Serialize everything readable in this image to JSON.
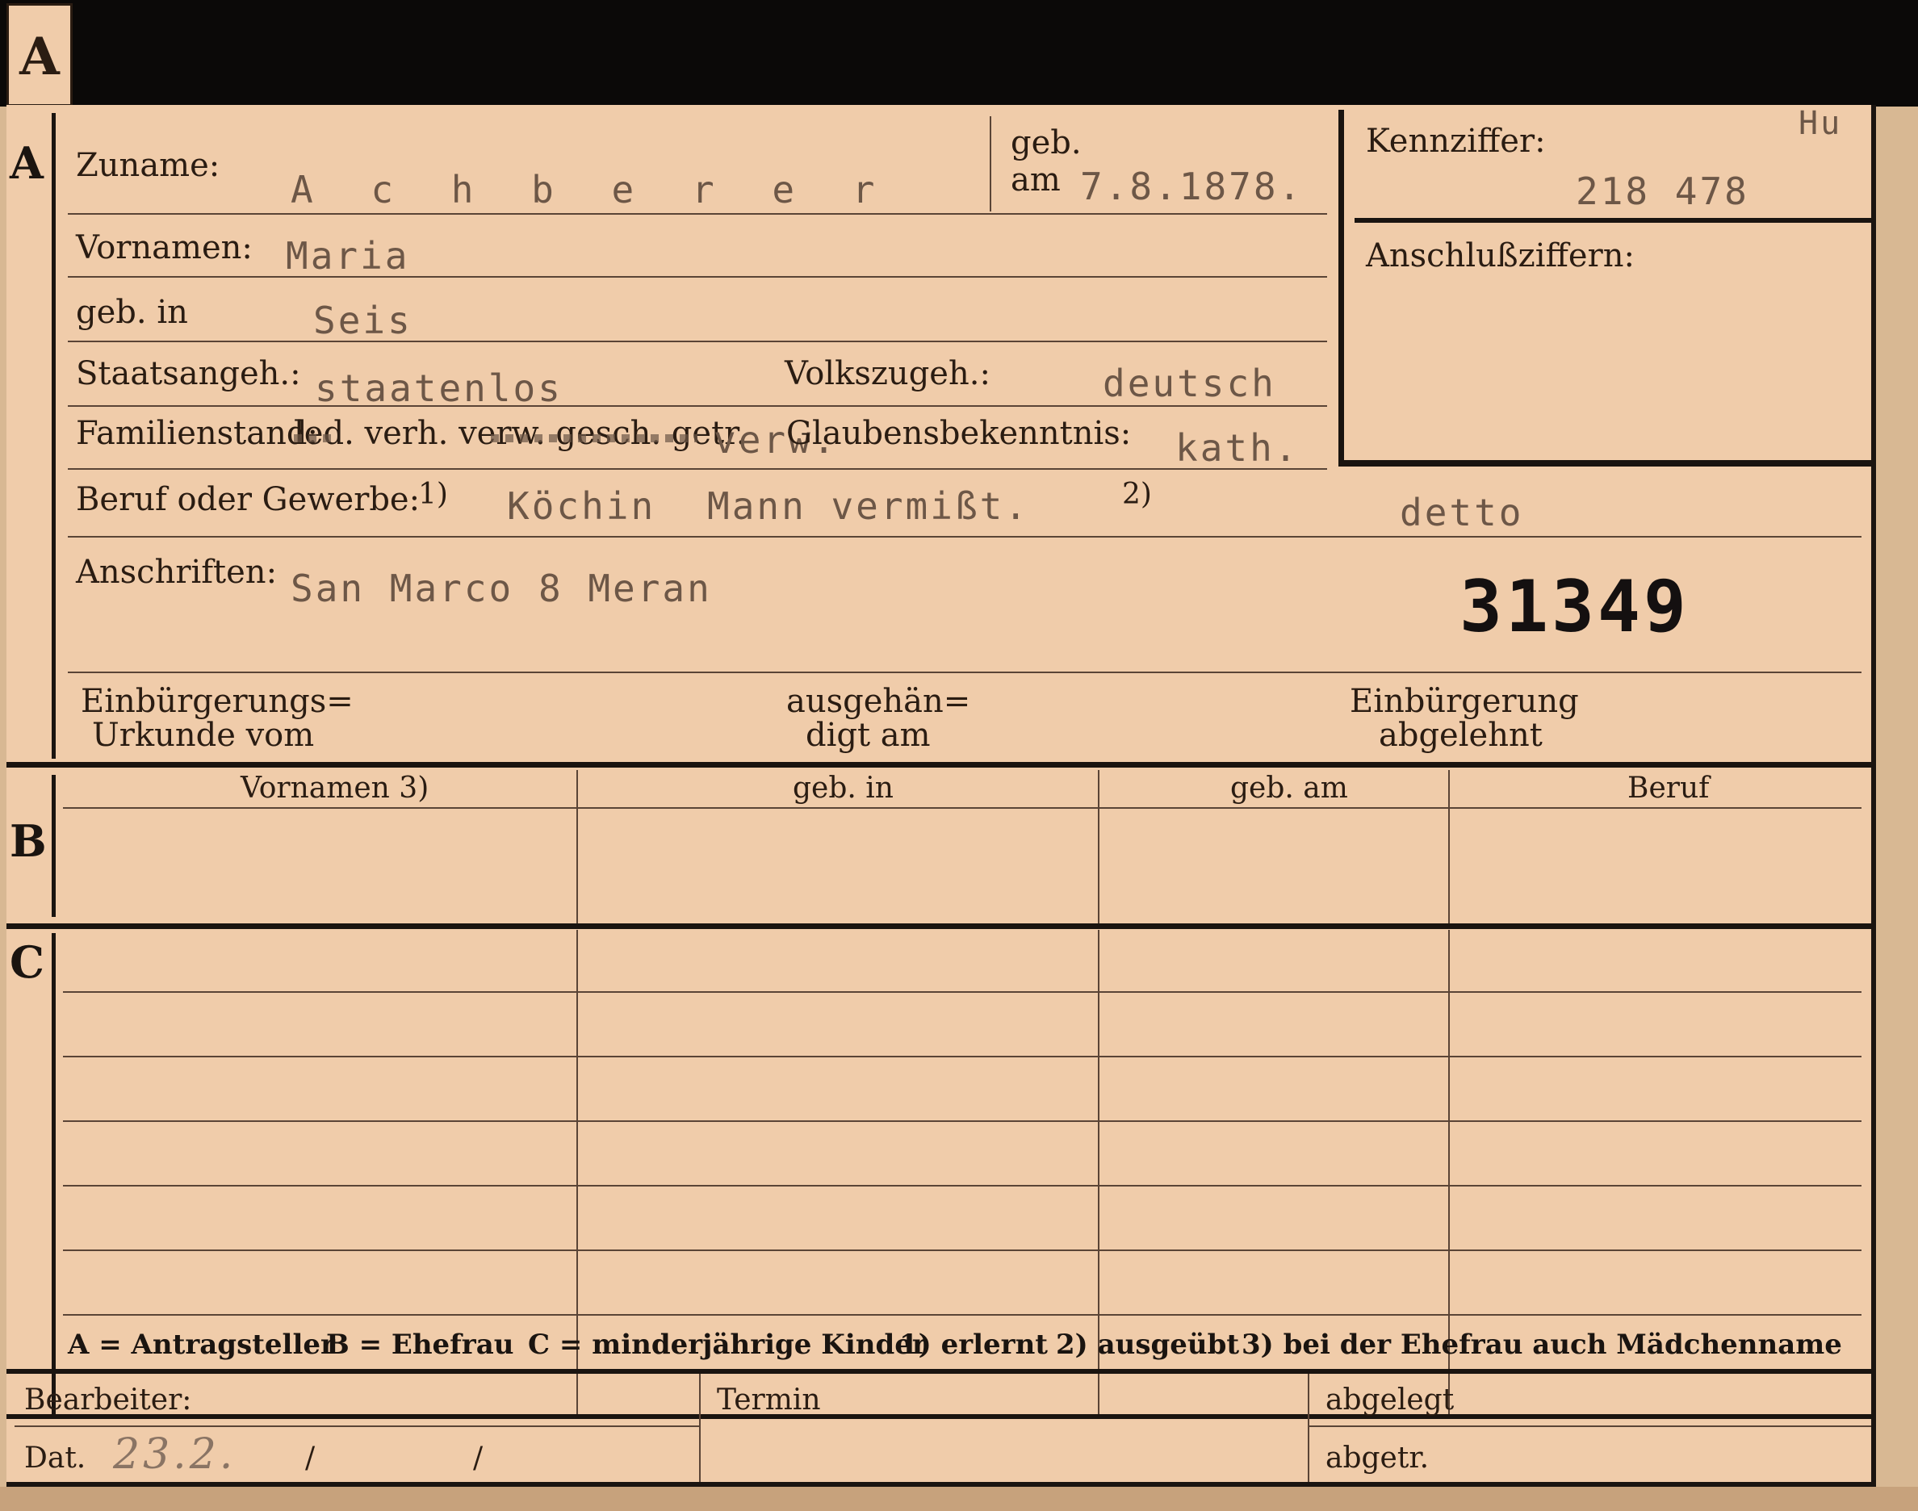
{
  "section_a": {
    "marker": "A",
    "surname_label": "Zuname:",
    "surname_value": "A c h b e r  e r",
    "birthdate_label_1": "geb.",
    "birthdate_label_2": "am",
    "birthdate_value": "7.8.1878.",
    "id_label": "Kennziffer:",
    "id_corner": "Hu",
    "id_value": "218 478",
    "link_label": "Anschlußziffern:",
    "firstname_label": "Vornamen:",
    "firstname_value": "Maria",
    "birthplace_label": "geb. in",
    "birthplace_value": "Seis",
    "nationality_label": "Staatsangeh.:",
    "nationality_value": "staatenlos",
    "ethnicity_label": "Volkszugeh.:",
    "ethnicity_value": "deutsch",
    "marital_label": "Familienstand:",
    "marital_options": "led. verh. verw. gesch. getr.",
    "marital_value": "verw.",
    "religion_label": "Glaubensbekenntnis:",
    "religion_value": "kath.",
    "occupation_label": "Beruf oder Gewerbe:",
    "occ_note1": "1)",
    "occupation_value": "Köchin",
    "occupation_remark": "Mann vermißt.",
    "occ_note2": "2)",
    "occupation_value2": "detto",
    "address_label": "Anschriften:",
    "address_value": "San Marco 8 Meran",
    "stamp_number": "31349",
    "naturalization_label_1": "Einbürgerungs=",
    "naturalization_label_2": "Urkunde vom",
    "handed_label_1": "ausgehän=",
    "handed_label_2": "digt am",
    "rejected_label_1": "Einbürgerung",
    "rejected_label_2": "abgelehnt"
  },
  "section_b": {
    "marker": "B",
    "columns": [
      "Vornamen 3)",
      "geb. in",
      "geb. am",
      "Beruf"
    ]
  },
  "section_c": {
    "marker": "C"
  },
  "legend": {
    "a": "A = Antragsteller",
    "b": "B = Ehefrau",
    "c": "C = minderjährige Kinder",
    "n1": "1) erlernt",
    "n2": "2) ausgeübt",
    "n3": "3) bei der Ehefrau auch Mädchenname"
  },
  "footer": {
    "processor_label": "Bearbeiter:",
    "date_label": "Dat.",
    "date_value": "23.2.",
    "slash1": "/",
    "slash2": "/",
    "deadline_label": "Termin",
    "filed_label": "abgelegt",
    "copied_label": "abgetr."
  }
}
